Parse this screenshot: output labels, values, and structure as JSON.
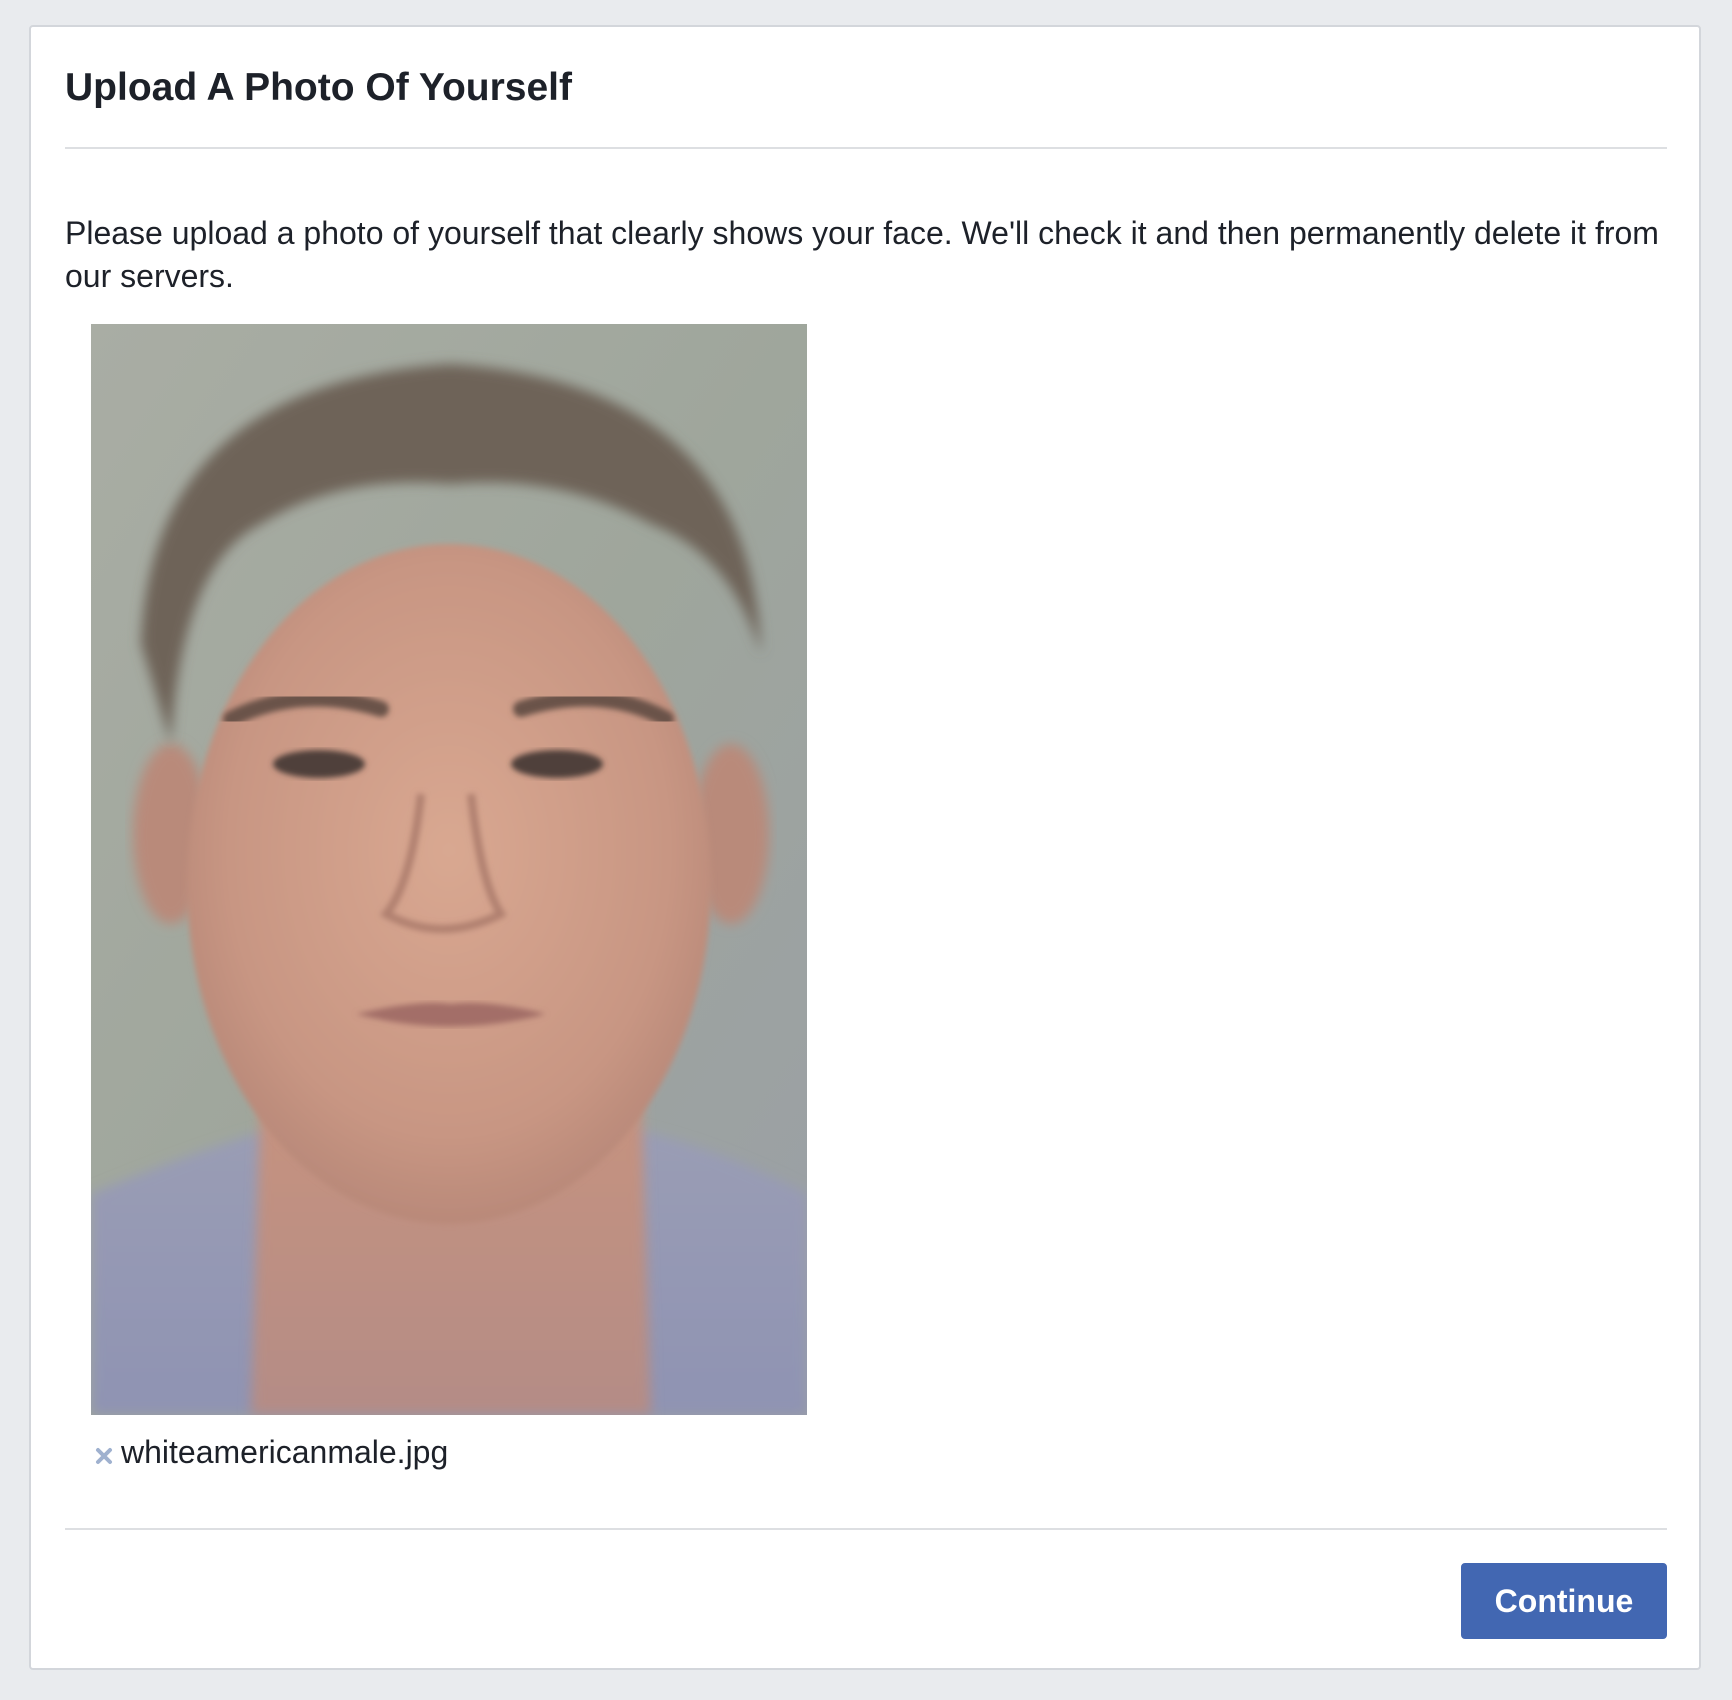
{
  "dialog": {
    "title": "Upload A Photo Of Yourself",
    "instructions": "Please upload a photo of yourself that clearly shows your face. We'll check it and then permanently delete it from our servers."
  },
  "upload": {
    "file_name": "whiteamericanmale.jpg",
    "remove_icon": "close-icon"
  },
  "footer": {
    "continue_label": "Continue"
  },
  "colors": {
    "page_background": "#e9ebee",
    "primary_button": "#4267b2",
    "text": "#1d2129",
    "divider": "#dddfe2"
  }
}
